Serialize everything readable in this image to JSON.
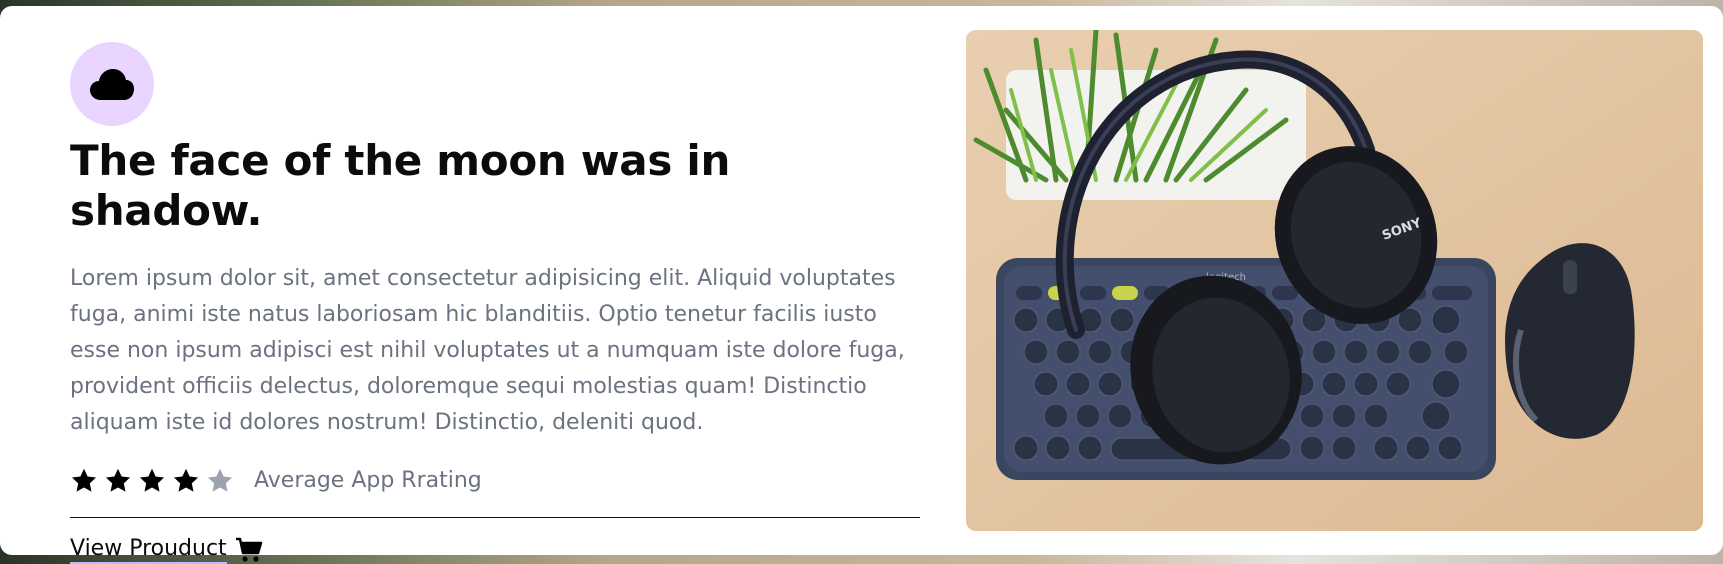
{
  "card": {
    "title": "The face of the moon was in shadow.",
    "description": "Lorem ipsum dolor sit, amet consectetur adipisicing elit. Aliquid voluptates fuga, animi iste natus laboriosam hic blanditiis. Optio tenetur facilis iusto esse non ipsum adipisci est nihil voluptates ut a numquam iste dolore fuga, provident officiis delectus, doloremque sequi molestias quam! Distinctio aliquam iste id dolores nostrum! Distinctio, deleniti quod.",
    "header_icon": "cloud-icon",
    "icon_bg_color": "#e9d5ff",
    "rating": {
      "value": 4,
      "max": 5,
      "label": "Average App Rrating",
      "filled_color": "#000000",
      "empty_color": "#9ca3af"
    },
    "link": {
      "label": "View Prouduct",
      "icon": "cart-icon"
    },
    "product_image": {
      "logo_text": "logitech",
      "brand_text": "SONY"
    }
  }
}
